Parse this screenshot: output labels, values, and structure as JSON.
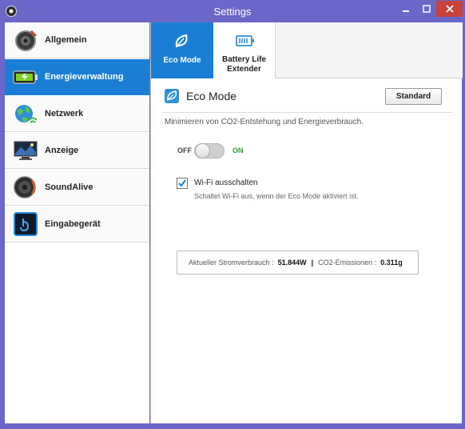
{
  "window": {
    "title": "Settings"
  },
  "sidebar": {
    "items": [
      {
        "label": "Allgemein",
        "icon": "speaker-gear-icon",
        "active": false
      },
      {
        "label": "Energieverwaltung",
        "icon": "battery-icon",
        "active": true
      },
      {
        "label": "Netzwerk",
        "icon": "globe-wifi-icon",
        "active": false
      },
      {
        "label": "Anzeige",
        "icon": "monitor-icon",
        "active": false
      },
      {
        "label": "SoundAlive",
        "icon": "speaker-icon",
        "active": false
      },
      {
        "label": "Eingabegerät",
        "icon": "touchpad-icon",
        "active": false
      }
    ]
  },
  "tabs": [
    {
      "label": "Eco Mode",
      "icon": "leaf-icon",
      "active": true
    },
    {
      "label_line1": "Battery Life",
      "label_line2": "Extender",
      "icon": "battery-extender-icon",
      "active": false
    }
  ],
  "eco": {
    "title": "Eco Mode",
    "standard_button": "Standard",
    "description": "Minimieren von CO2-Entstehung und Energieverbrauch.",
    "toggle": {
      "off_label": "OFF",
      "on_label": "ON",
      "state": "off"
    },
    "wifi": {
      "label": "Wi-Fi ausschalten",
      "description": "Schaltet Wi-Fi aus, wenn der Eco Mode aktiviert ist.",
      "checked": true
    },
    "stats": {
      "power_label": "Aktueller Stromverbrauch :",
      "power_value": "51.844W",
      "separator": "|",
      "co2_label": "CO2-Emissionen :",
      "co2_value": "0.311g"
    }
  },
  "colors": {
    "accent": "#1a7fd4",
    "titlebar": "#6a67c9",
    "close": "#c9433b",
    "on_green": "#2e9c2e"
  }
}
